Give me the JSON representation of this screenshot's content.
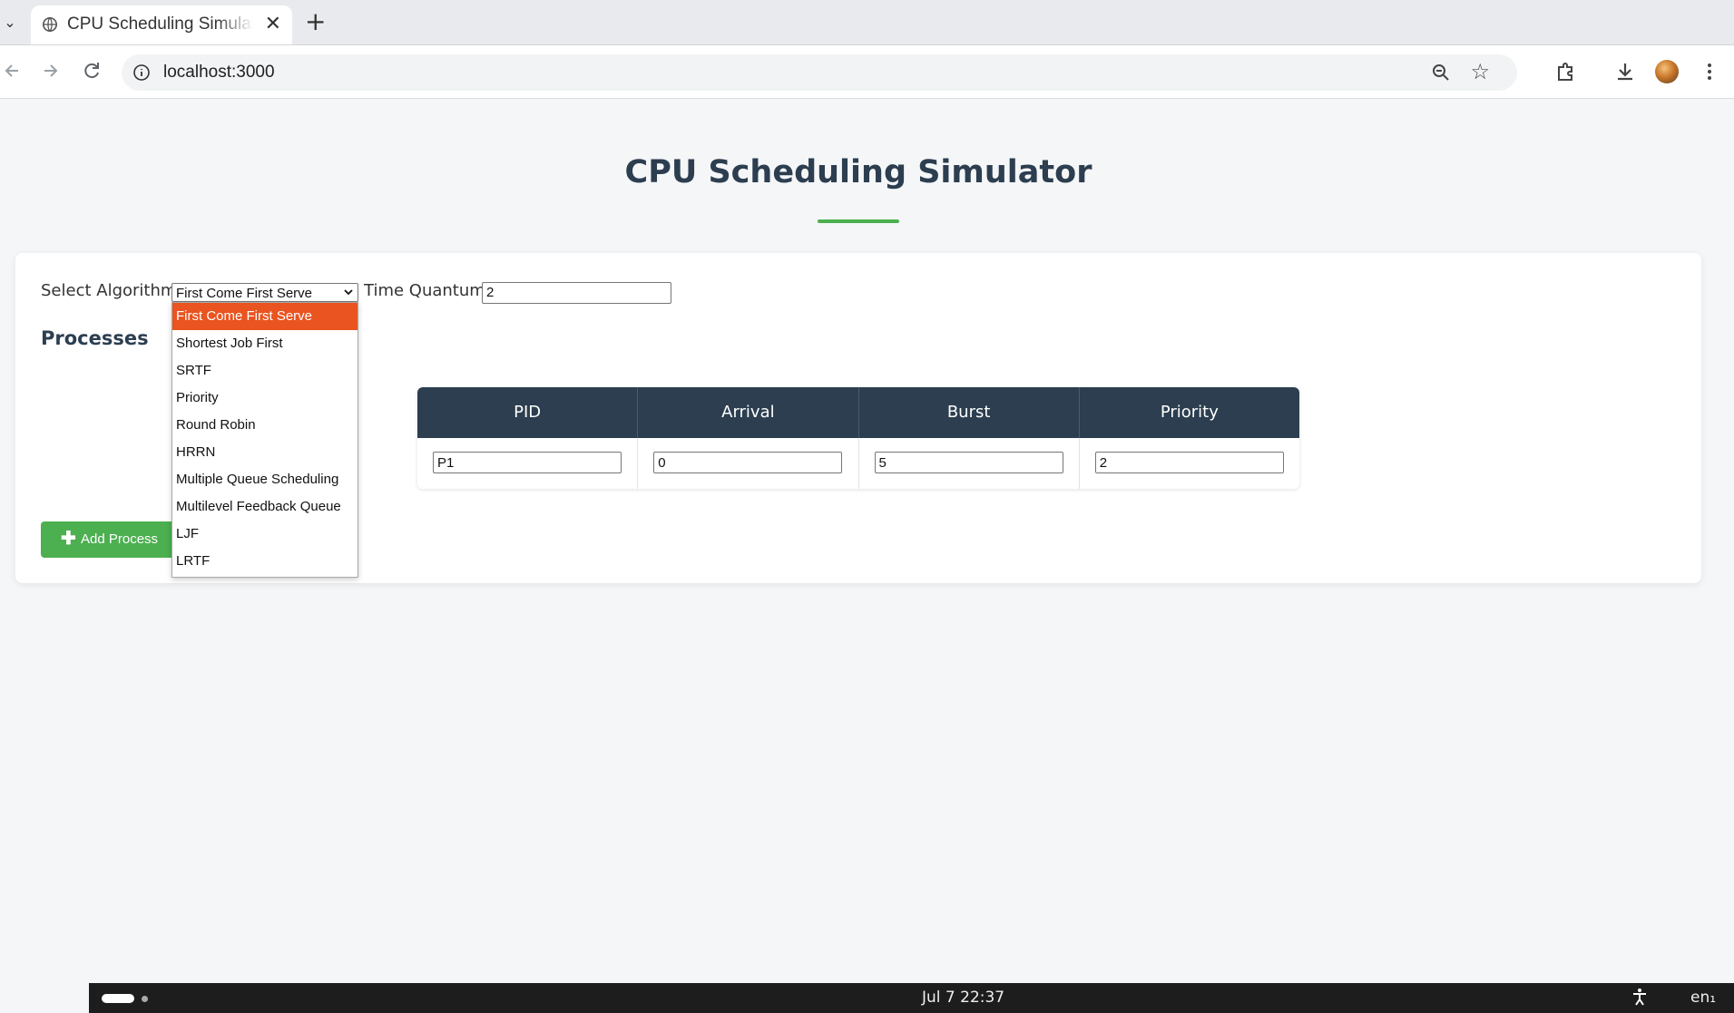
{
  "browser": {
    "tab_title": "CPU Scheduling Simulator",
    "url": "localhost:3000",
    "new_tab": "+",
    "tab_close": "✕",
    "tab_list": "⌄"
  },
  "page": {
    "title": "CPU Scheduling Simulator",
    "accent_color": "#4caf50",
    "header_color": "#2c3e50"
  },
  "controls": {
    "algorithm_label": "Select Algorithm:",
    "algorithm_selected": "First Come First Serve",
    "quantum_label": "Time Quantum:",
    "quantum_value": "2"
  },
  "algorithm_options": [
    "First Come First Serve",
    "Shortest Job First",
    "SRTF",
    "Priority",
    "Round Robin",
    "HRRN",
    "Multiple Queue Scheduling",
    "Multilevel Feedback Queue",
    "LJF",
    "LRTF"
  ],
  "dropdown_highlight_color": "#e95420",
  "processes": {
    "heading": "Processes",
    "columns": [
      "PID",
      "Arrival",
      "Burst",
      "Priority"
    ],
    "rows": [
      {
        "pid": "P1",
        "arrival": "0",
        "burst": "5",
        "priority": "2"
      }
    ],
    "add_button": "Add Process"
  },
  "taskbar": {
    "clock": "Jul 7  22:37",
    "language": "en₁"
  }
}
